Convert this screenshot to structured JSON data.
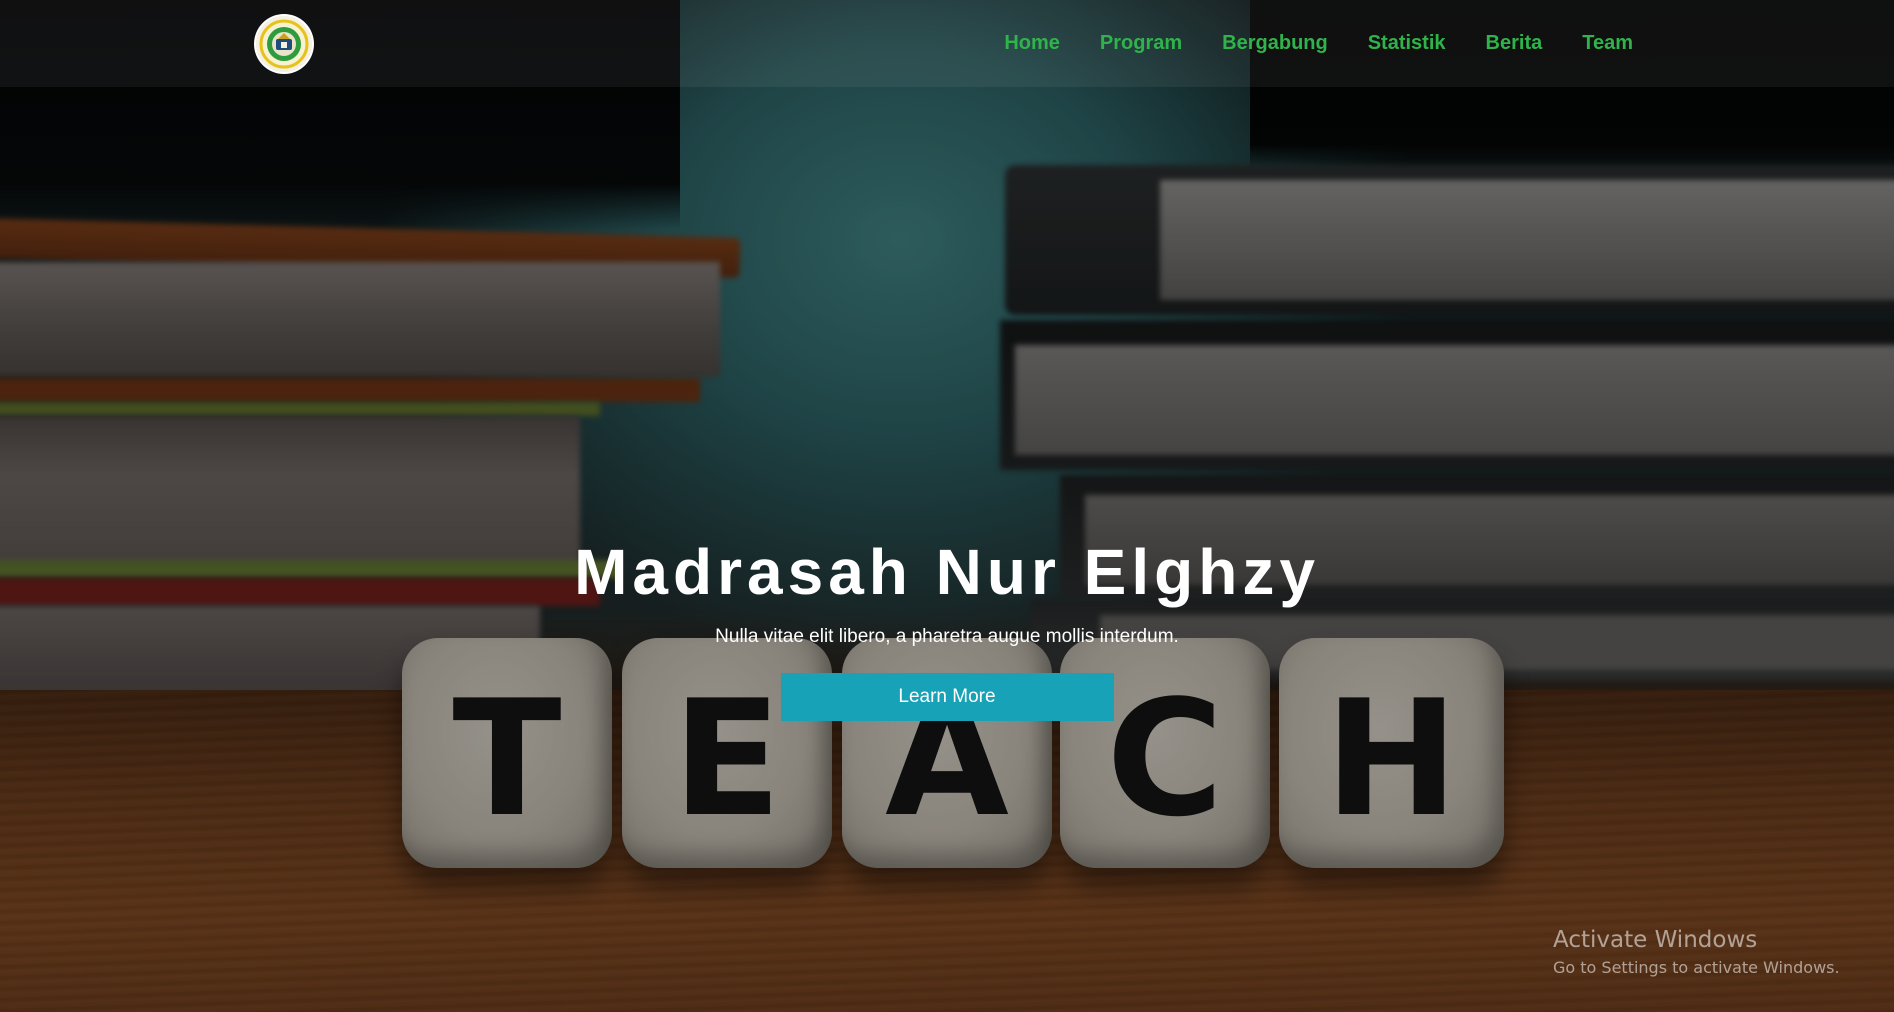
{
  "navbar": {
    "logo_alt": "Madrasah logo",
    "links": [
      "Home",
      "Program",
      "Bergabung",
      "Statistik",
      "Berita",
      "Team"
    ]
  },
  "hero": {
    "title": "Madrasah Nur Elghzy",
    "subtitle": "Nulla vitae elit libero, a pharetra augue mollis interdum.",
    "button_label": "Learn More",
    "dice_letters": [
      "T",
      "E",
      "A",
      "C",
      "H"
    ]
  },
  "watermark": {
    "title": "Activate Windows",
    "subtitle": "Go to Settings to activate Windows."
  },
  "colors": {
    "nav_link": "#2fb34a",
    "button": "#17a2b8",
    "text": "#ffffff"
  }
}
